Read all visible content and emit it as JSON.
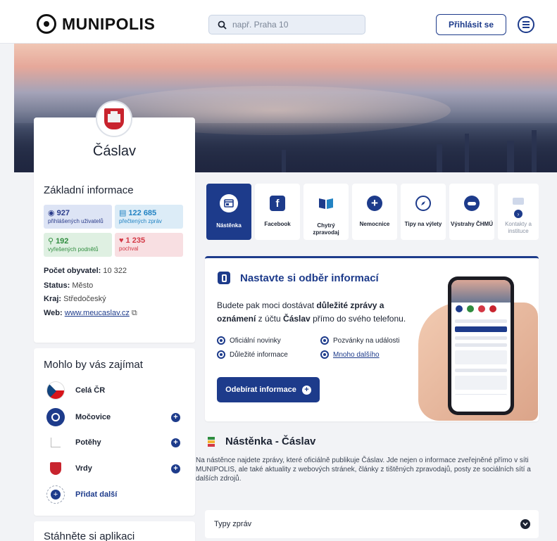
{
  "header": {
    "logo_text": "MUNIPOLIS",
    "search_placeholder": "např. Praha 10",
    "login_label": "Přihlásit se"
  },
  "city": {
    "name": "Čáslav",
    "basic_info_title": "Základní informace",
    "stats": [
      {
        "value": "927",
        "label": "přihlášených uživatelů"
      },
      {
        "value": "122 685",
        "label": "přečtených zpráv"
      },
      {
        "value": "192",
        "label": "vyřešených podnětů"
      },
      {
        "value": "1 235",
        "label": "pochval"
      }
    ],
    "info": {
      "population_label": "Počet obyvatel:",
      "population_value": "10 322",
      "status_label": "Status:",
      "status_value": "Město",
      "region_label": "Kraj:",
      "region_value": "Středočeský",
      "web_label": "Web:",
      "web_value": "www.meucaslav.cz"
    }
  },
  "interest": {
    "title": "Mohlo by vás zajímat",
    "items": [
      {
        "label": "Celá ČR"
      },
      {
        "label": "Močovice"
      },
      {
        "label": "Potěhy"
      },
      {
        "label": "Vrdy"
      },
      {
        "label": "Přidat další"
      }
    ]
  },
  "app_section": {
    "title": "Stáhněte si aplikaci"
  },
  "tabs": [
    {
      "label": "Nástěnka",
      "icon": "board-icon"
    },
    {
      "label": "Facebook",
      "icon": "facebook-icon"
    },
    {
      "label": "Chytrý zpravodaj",
      "icon": "newsletter-icon"
    },
    {
      "label": "Nemocnice",
      "icon": "hospital-cross-icon"
    },
    {
      "label": "Tipy na výlety",
      "icon": "compass-icon"
    },
    {
      "label": "Výstrahy ČHMÚ",
      "icon": "weather-warning-icon"
    },
    {
      "label": "Kontakty a instituce",
      "icon": "contacts-icon"
    }
  ],
  "subscribe": {
    "title": "Nastavte si odběr informací",
    "desc_pre": "Budete pak moci dostávat ",
    "desc_bold": "důležité zprávy a oznámení",
    "desc_mid": " z účtu ",
    "desc_city": "Čáslav",
    "desc_post": " přímo do svého telefonu.",
    "features": [
      "Oficiální novinky",
      "Pozvánky na události",
      "Důležité informace",
      "Mnoho dalšího"
    ],
    "button_label": "Odebírat informace"
  },
  "board": {
    "title": "Nástěnka - Čáslav",
    "description": "Na nástěnce najdete zprávy, které oficiálně publikuje Čáslav. Jde nejen o informace zveřejněné přímo v síti MUNIPOLIS, ale také aktuality z webových stránek, články z tištěných zpravodajů, posty ze sociálních sítí a dalších zdrojů.",
    "types_label": "Typy zpráv"
  },
  "colors": {
    "brand": "#1d3b8b",
    "green": "#2f8c3e",
    "red": "#d33744",
    "cyan": "#2383c3"
  }
}
